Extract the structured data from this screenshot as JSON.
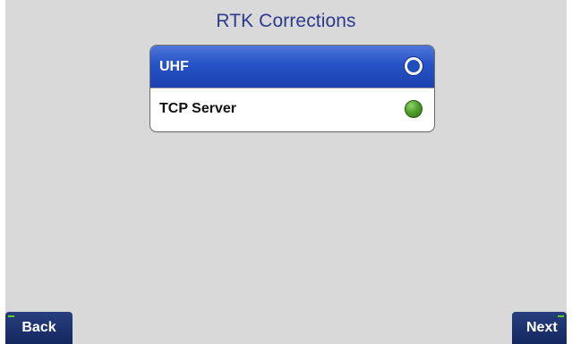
{
  "screen": {
    "title": "RTK Corrections"
  },
  "options": [
    {
      "label": "UHF",
      "selected": true
    },
    {
      "label": "TCP Server",
      "selected": false
    }
  ],
  "navigation": {
    "back_label": "Back",
    "next_label": "Next"
  },
  "colors": {
    "title": "#2b3a8c",
    "selected_row": "#2553c7",
    "nav_button": "#1b2f6b",
    "status_green": "#4fa02c",
    "background": "#d9d9d9"
  },
  "icons": {
    "selected": "radio-selected-icon",
    "unselected": "radio-unselected-icon"
  }
}
